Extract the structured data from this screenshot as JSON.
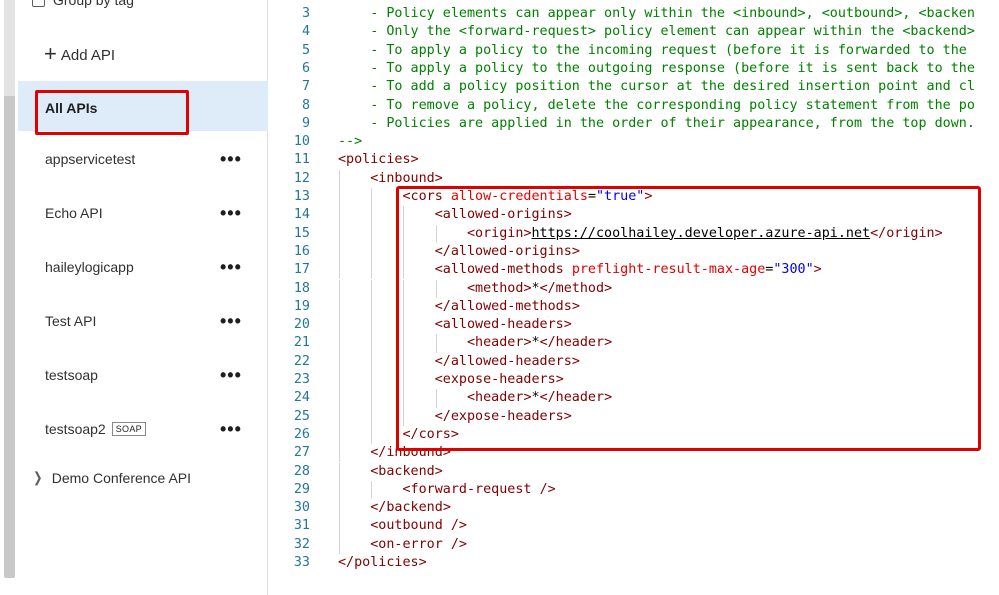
{
  "sidebar": {
    "group_by_tag_label": "Group by tag",
    "add_api_label": "Add API",
    "selected_label": "All APIs",
    "apis": [
      {
        "name": "appservicetest",
        "badge": ""
      },
      {
        "name": "Echo API",
        "badge": ""
      },
      {
        "name": "haileylogicapp",
        "badge": ""
      },
      {
        "name": "Test API",
        "badge": ""
      },
      {
        "name": "testsoap",
        "badge": ""
      },
      {
        "name": "testsoap2",
        "badge": "SOAP"
      }
    ],
    "more_label": "•••",
    "group_name": "Demo Conference API"
  },
  "editor": {
    "lines": [
      {
        "n": "3",
        "t": "    - Policy elements can appear only within the <inbound>, <outbound>, <backen"
      },
      {
        "n": "4",
        "t": "    - Only the <forward-request> policy element can appear within the <backend>"
      },
      {
        "n": "5",
        "t": "    - To apply a policy to the incoming request (before it is forwarded to the"
      },
      {
        "n": "6",
        "t": "    - To apply a policy to the outgoing response (before it is sent back to the"
      },
      {
        "n": "7",
        "t": "    - To add a policy position the cursor at the desired insertion point and cl"
      },
      {
        "n": "8",
        "t": "    - To remove a policy, delete the corresponding policy statement from the po"
      },
      {
        "n": "9",
        "t": "    - Policies are applied in the order of their appearance, from the top down."
      },
      {
        "n": "10",
        "t": "-->"
      },
      {
        "n": "11",
        "t": "<policies>"
      },
      {
        "n": "12",
        "t": "    <inbound>"
      },
      {
        "n": "13",
        "t": "        <cors allow-credentials=\"true\">"
      },
      {
        "n": "14",
        "t": "            <allowed-origins>"
      },
      {
        "n": "15",
        "t": "                <origin>https://coolhailey.developer.azure-api.net</origin>"
      },
      {
        "n": "16",
        "t": "            </allowed-origins>"
      },
      {
        "n": "17",
        "t": "            <allowed-methods preflight-result-max-age=\"300\">"
      },
      {
        "n": "18",
        "t": "                <method>*</method>"
      },
      {
        "n": "19",
        "t": "            </allowed-methods>"
      },
      {
        "n": "20",
        "t": "            <allowed-headers>"
      },
      {
        "n": "21",
        "t": "                <header>*</header>"
      },
      {
        "n": "22",
        "t": "            </allowed-headers>"
      },
      {
        "n": "23",
        "t": "            <expose-headers>"
      },
      {
        "n": "24",
        "t": "                <header>*</header>"
      },
      {
        "n": "25",
        "t": "            </expose-headers>"
      },
      {
        "n": "26",
        "t": "        </cors>"
      },
      {
        "n": "27",
        "t": "    </inbound>"
      },
      {
        "n": "28",
        "t": "    <backend>"
      },
      {
        "n": "29",
        "t": "        <forward-request />"
      },
      {
        "n": "30",
        "t": "    </backend>"
      },
      {
        "n": "31",
        "t": "    <outbound />"
      },
      {
        "n": "32",
        "t": "    <on-error />"
      },
      {
        "n": "33",
        "t": "</policies>"
      }
    ]
  },
  "colors": {
    "highlight_border": "#e00000",
    "selected_bg": "#deecf9",
    "xml_tag": "#800000",
    "xml_attr": "#e50000",
    "xml_value": "#0000ff",
    "comment": "#008000",
    "line_number": "#237893"
  }
}
